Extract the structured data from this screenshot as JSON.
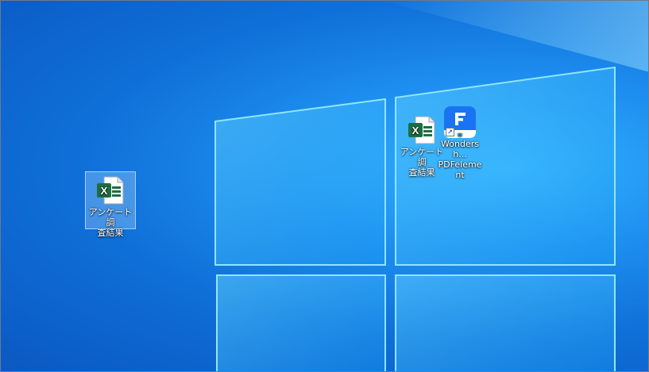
{
  "desktop": {
    "icons": [
      {
        "label_line1": "アンケート調",
        "label_line2": "査結果",
        "type": "excel-file",
        "selected": true
      },
      {
        "label_line1": "アンケート調",
        "label_line2": "査結果",
        "type": "excel-file",
        "selected": false
      },
      {
        "label_line1": "Wondersh...",
        "label_line2": "PDFelement",
        "type": "pdfelement-app",
        "selected": false
      }
    ]
  },
  "colors": {
    "excel_green": "#1d6f42",
    "pdfelement_blue": "#1a73f2",
    "desktop_blue": "#0f6fd8"
  }
}
